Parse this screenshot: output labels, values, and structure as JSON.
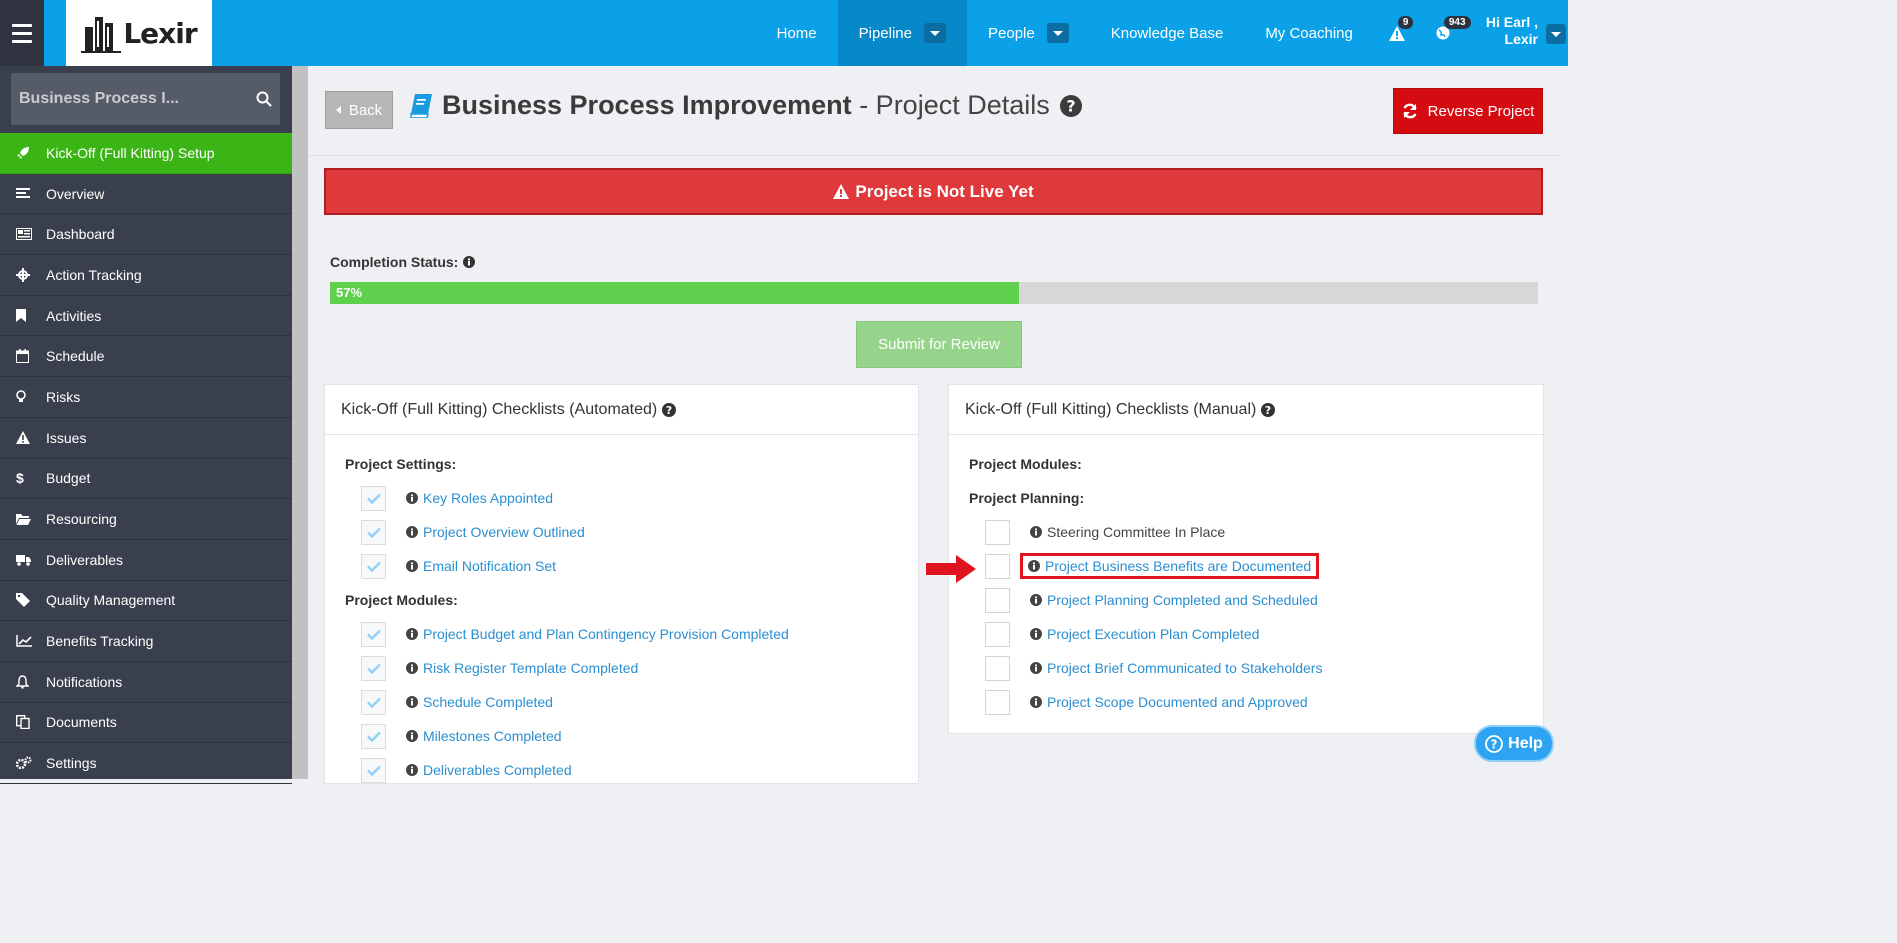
{
  "brand": {
    "logo_text": "Lexir"
  },
  "nav": {
    "items": [
      "Home",
      "Pipeline",
      "People",
      "Knowledge Base",
      "My Coaching"
    ],
    "alerts_count": "9",
    "globe_count": "943",
    "user_greeting": "Hi Earl ,",
    "user_name": "Lexir"
  },
  "sidebar": {
    "search_placeholder": "Business Process I...",
    "items": [
      {
        "label": "Kick-Off (Full Kitting) Setup",
        "icon": "rocket-icon"
      },
      {
        "label": "Overview",
        "icon": "align-left-icon"
      },
      {
        "label": "Dashboard",
        "icon": "newspaper-icon"
      },
      {
        "label": "Action Tracking",
        "icon": "crosshairs-icon"
      },
      {
        "label": "Activities",
        "icon": "bookmark-icon"
      },
      {
        "label": "Schedule",
        "icon": "calendar-icon"
      },
      {
        "label": "Risks",
        "icon": "lightbulb-icon"
      },
      {
        "label": "Issues",
        "icon": "warning-icon"
      },
      {
        "label": "Budget",
        "icon": "dollar-icon"
      },
      {
        "label": "Resourcing",
        "icon": "folder-icon"
      },
      {
        "label": "Deliverables",
        "icon": "truck-icon"
      },
      {
        "label": "Quality Management",
        "icon": "tag-icon"
      },
      {
        "label": "Benefits Tracking",
        "icon": "line-chart-icon"
      },
      {
        "label": "Notifications",
        "icon": "bell-icon"
      },
      {
        "label": "Documents",
        "icon": "documents-icon"
      },
      {
        "label": "Settings",
        "icon": "cogs-icon"
      }
    ]
  },
  "header": {
    "back_label": "Back",
    "title_bold": "Business Process Improvement",
    "title_rest": "- Project Details",
    "reverse_label": "Reverse Project"
  },
  "alert": {
    "text": "Project is Not Live Yet"
  },
  "completion": {
    "label": "Completion Status:",
    "percent": 57,
    "percent_text": "57%"
  },
  "submit_label": "Submit for Review",
  "automated": {
    "title": "Kick-Off (Full Kitting) Checklists (Automated)",
    "settings_label": "Project Settings:",
    "settings_items": [
      "Key Roles Appointed",
      "Project Overview Outlined",
      "Email Notification Set"
    ],
    "modules_label": "Project Modules:",
    "modules_items": [
      "Project Budget and Plan Contingency Provision Completed",
      "Risk Register Template Completed",
      "Schedule Completed",
      "Milestones Completed",
      "Deliverables Completed"
    ]
  },
  "manual": {
    "title": "Kick-Off (Full Kitting) Checklists (Manual)",
    "modules_label": "Project Modules:",
    "planning_label": "Project Planning:",
    "planning_items": [
      "Steering Committee In Place",
      "Project Business Benefits are Documented",
      "Project Planning Completed and Scheduled",
      "Project Execution Plan Completed",
      "Project Brief Communicated to Stakeholders",
      "Project Scope Documented and Approved"
    ]
  },
  "help_label": "Help",
  "colors": {
    "nav_bg": "#0aa1e8",
    "sidebar_bg": "#3a3f4d",
    "active_green": "#3ab515",
    "danger_red": "#d50b12",
    "progress_green": "#5fcf4e"
  }
}
